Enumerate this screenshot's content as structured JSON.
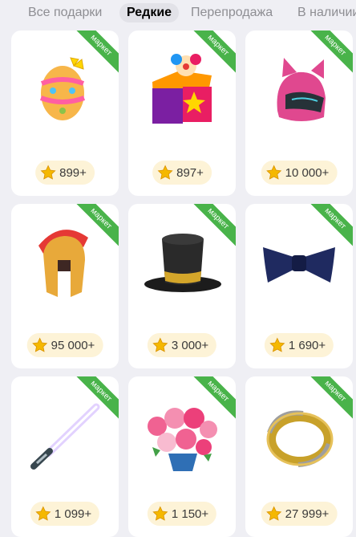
{
  "tabs": [
    {
      "label": "Все подарки",
      "active": false
    },
    {
      "label": "Редкие",
      "active": true
    },
    {
      "label": "Перепродажа",
      "active": false
    },
    {
      "label": "В наличии",
      "active": false
    }
  ],
  "gifts": [
    {
      "item": "easter-egg",
      "badge": "маркет",
      "price": "899+"
    },
    {
      "item": "jack-in-the-box",
      "badge": "маркет",
      "price": "897+"
    },
    {
      "item": "cat-helmet",
      "badge": "маркет",
      "price": "10 000+"
    },
    {
      "item": "spartan-helmet",
      "badge": "маркет",
      "price": "95 000+"
    },
    {
      "item": "top-hat",
      "badge": "маркет",
      "price": "3 000+"
    },
    {
      "item": "bow-tie",
      "badge": "маркет",
      "price": "1 690+"
    },
    {
      "item": "light-sword",
      "badge": "маркет",
      "price": "1 099+"
    },
    {
      "item": "flower-bouquet",
      "badge": "маркет",
      "price": "1 150+"
    },
    {
      "item": "gold-ring",
      "badge": "маркет",
      "price": "27 999+"
    }
  ],
  "colors": {
    "badge": "#49b34a",
    "price_pill": "#fdf3d7",
    "star": "#f5b800"
  }
}
